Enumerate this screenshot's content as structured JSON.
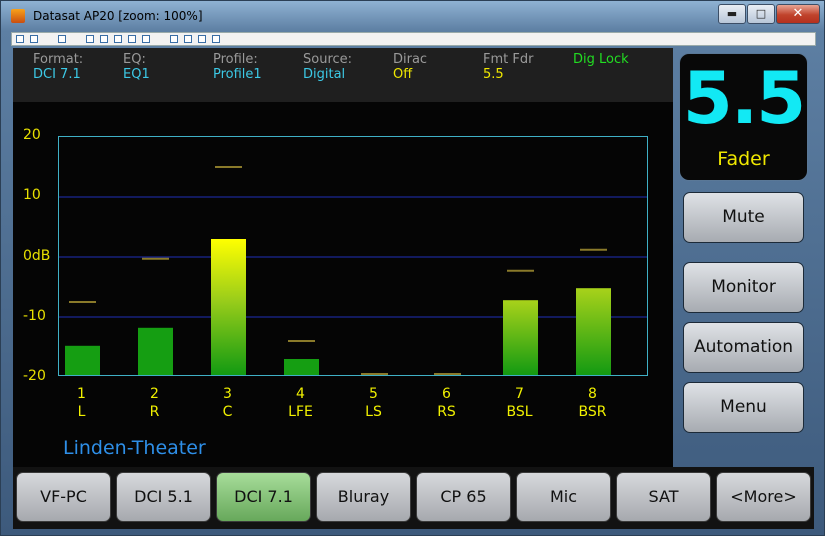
{
  "window": {
    "title": "Datasat AP20 [zoom: 100%]",
    "colors": {
      "accent": "#12e9f4",
      "yellow": "#f0e800",
      "green": "#22dd22"
    }
  },
  "info": [
    {
      "label": "Format:",
      "value": "DCI 7.1",
      "color": "#3cc9e6"
    },
    {
      "label": "EQ:",
      "value": "EQ1",
      "color": "#3cc9e6"
    },
    {
      "label": "Profile:",
      "value": "Profile1",
      "color": "#3cc9e6"
    },
    {
      "label": "Source:",
      "value": "Digital",
      "color": "#3cc9e6"
    },
    {
      "label": "Dirac",
      "value": "Off",
      "color": "#f0e800"
    },
    {
      "label": "Fmt Fdr",
      "value": "5.5",
      "color": "#f0e800"
    },
    {
      "label": "",
      "value": "Dig Lock",
      "color": "#22dd22"
    }
  ],
  "theater_name": "Linden-Theater",
  "fader": {
    "value": "5.5",
    "label": "Fader"
  },
  "side_buttons": [
    "Mute",
    "Monitor",
    "Automation",
    "Menu"
  ],
  "tabs": [
    {
      "label": "VF-PC",
      "active": false
    },
    {
      "label": "DCI 5.1",
      "active": false
    },
    {
      "label": "DCI 7.1",
      "active": true
    },
    {
      "label": "Bluray",
      "active": false
    },
    {
      "label": "CP 65",
      "active": false
    },
    {
      "label": "Mic",
      "active": false
    },
    {
      "label": "SAT",
      "active": false
    },
    {
      "label": "<More>",
      "active": false
    }
  ],
  "chart_data": {
    "type": "bar",
    "ylim": [
      -20,
      20
    ],
    "y_ticks": [
      "20",
      "10",
      "0dB",
      "-10",
      "-20"
    ],
    "y_tick_values": [
      20,
      10,
      0,
      -10,
      -20
    ],
    "grid": true,
    "categories": [
      "1",
      "2",
      "3",
      "4",
      "5",
      "6",
      "7",
      "8"
    ],
    "category_names": [
      "L",
      "R",
      "C",
      "LFE",
      "LS",
      "RS",
      "BSL",
      "BSR"
    ],
    "values": [
      -14.8,
      -11.8,
      3,
      -17,
      -20,
      -20,
      -7.2,
      -5.2
    ],
    "peak_values": [
      -7.5,
      -0.3,
      15,
      -14,
      -19.5,
      -19.5,
      -2.3,
      1.2
    ]
  }
}
